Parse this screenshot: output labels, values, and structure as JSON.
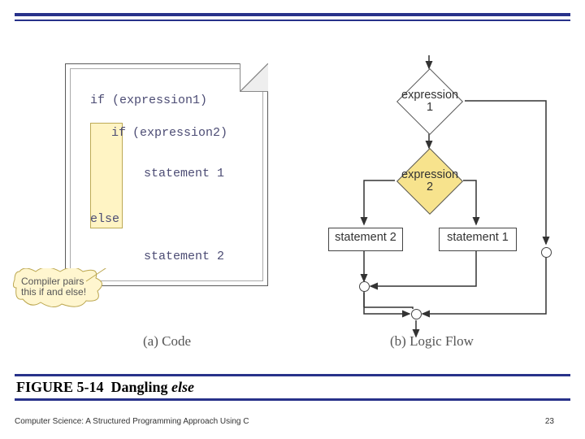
{
  "rules": {
    "topY": 16,
    "top2Y": 24
  },
  "caption": {
    "fig": "FIGURE 5-14",
    "title": "Dangling",
    "else": "else"
  },
  "footer": {
    "text": "Computer Science: A Structured Programming Approach Using C",
    "page": "23"
  },
  "code": {
    "line1": "if (expression1)",
    "line2": "if",
    "line2b": "(expression2)",
    "line3": "statement 1",
    "line4": "else",
    "line5": "statement 2",
    "callout1": "Compiler pairs",
    "callout2": "this if and else!",
    "sub": "(a) Code"
  },
  "flow": {
    "d1": "expression\n1",
    "d2": "expression\n2",
    "b1": "statement 2",
    "b2": "statement 1",
    "sub": "(b) Logic Flow"
  }
}
